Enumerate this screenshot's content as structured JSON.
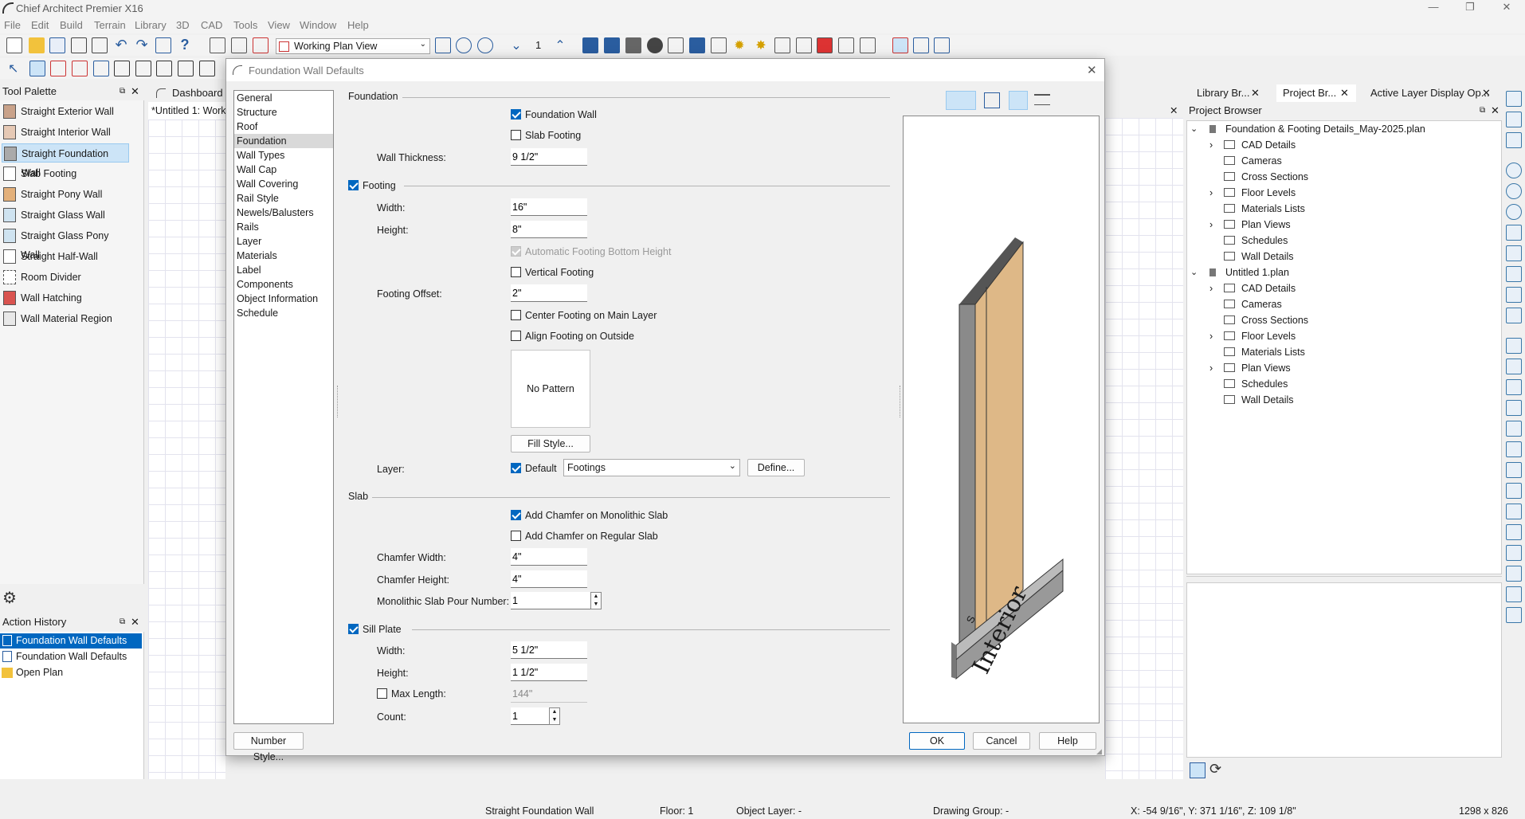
{
  "app": {
    "title": "Chief Architect Premier X16"
  },
  "menu": [
    "File",
    "Edit",
    "Build",
    "Terrain",
    "Library",
    "3D",
    "CAD",
    "Tools",
    "View",
    "Window",
    "Help"
  ],
  "toolbar": {
    "view_select": "Working Plan View",
    "floor_number": "1"
  },
  "tool_palette": {
    "title": "Tool Palette",
    "items": [
      "Straight Exterior Wall",
      "Straight Interior Wall",
      "Straight Foundation Wall",
      "Slab Footing",
      "Straight Pony Wall",
      "Straight Glass Wall",
      "Straight Glass Pony Wall",
      "Straight Half-Wall",
      "Room Divider",
      "Wall Hatching",
      "Wall Material Region"
    ]
  },
  "action_history": {
    "title": "Action History",
    "items": [
      "Foundation Wall Defaults",
      "Foundation Wall Defaults",
      "Open Plan"
    ]
  },
  "doc_tabs": {
    "dashboard": "Dashboard",
    "untitled": "*Untitled 1:  Work"
  },
  "dialog": {
    "title": "Foundation Wall Defaults",
    "nav": [
      "General",
      "Structure",
      "Roof",
      "Foundation",
      "Wall Types",
      "Wall Cap",
      "Wall Covering",
      "Rail Style",
      "Newels/Balusters",
      "Rails",
      "Layer",
      "Materials",
      "Label",
      "Components",
      "Object Information",
      "Schedule"
    ],
    "foundation": {
      "header": "Foundation",
      "foundation_wall": "Foundation Wall",
      "slab_footing": "Slab Footing",
      "wall_thickness_label": "Wall Thickness:",
      "wall_thickness": "9 1/2\""
    },
    "footing": {
      "header": "Footing",
      "width_label": "Width:",
      "width": "16\"",
      "height_label": "Height:",
      "height": "8\"",
      "auto_bottom": "Automatic Footing Bottom Height",
      "vertical": "Vertical Footing",
      "offset_label": "Footing Offset:",
      "offset": "2\"",
      "center": "Center Footing on Main Layer",
      "align": "Align Footing on Outside",
      "pattern": "No Pattern",
      "fill_style": "Fill Style...",
      "layer_label": "Layer:",
      "layer_default": "Default",
      "layer_value": "Footings",
      "define": "Define..."
    },
    "slab": {
      "header": "Slab",
      "chamfer_mono": "Add Chamfer on Monolithic Slab",
      "chamfer_regular": "Add Chamfer on Regular Slab",
      "chamfer_width_label": "Chamfer Width:",
      "chamfer_width": "4\"",
      "chamfer_height_label": "Chamfer Height:",
      "chamfer_height": "4\"",
      "pour_label": "Monolithic Slab Pour Number:",
      "pour": "1"
    },
    "sill": {
      "header": "Sill Plate",
      "width_label": "Width:",
      "width": "5 1/2\"",
      "height_label": "Height:",
      "height": "1 1/2\"",
      "max_length": "Max Length:",
      "max_length_value": "144\"",
      "count_label": "Count:",
      "count": "1"
    },
    "preview": {
      "label_interior": "Interior",
      "label_s": "S"
    },
    "buttons": {
      "number_style": "Number Style...",
      "ok": "OK",
      "cancel": "Cancel",
      "help": "Help"
    }
  },
  "right_tabs": [
    "Library Br...",
    "Project Br...",
    "Active Layer Display Op..."
  ],
  "project_browser": {
    "title": "Project Browser",
    "plans": [
      {
        "name": "Foundation & Footing Details_May-2025.plan",
        "children": [
          "CAD Details",
          "Cameras",
          "Cross Sections",
          "Floor Levels",
          "Materials Lists",
          "Plan Views",
          "Schedules",
          "Wall Details"
        ]
      },
      {
        "name": "Untitled 1.plan",
        "children": [
          "CAD Details",
          "Cameras",
          "Cross Sections",
          "Floor Levels",
          "Materials Lists",
          "Plan Views",
          "Schedules",
          "Wall Details"
        ]
      }
    ]
  },
  "status": {
    "tool": "Straight Foundation Wall",
    "floor": "Floor: 1",
    "layer": "Object Layer: -",
    "drawing_group": "Drawing Group: -",
    "coords": "X: -54 9/16\", Y: 371 1/16\", Z: 109 1/8\"",
    "size": "1298 x 826"
  },
  "colors": {
    "accent": "#0067c0",
    "wall_face": "#deb887",
    "wall_gray": "#8a8a8a",
    "selection": "#cce4f7"
  }
}
